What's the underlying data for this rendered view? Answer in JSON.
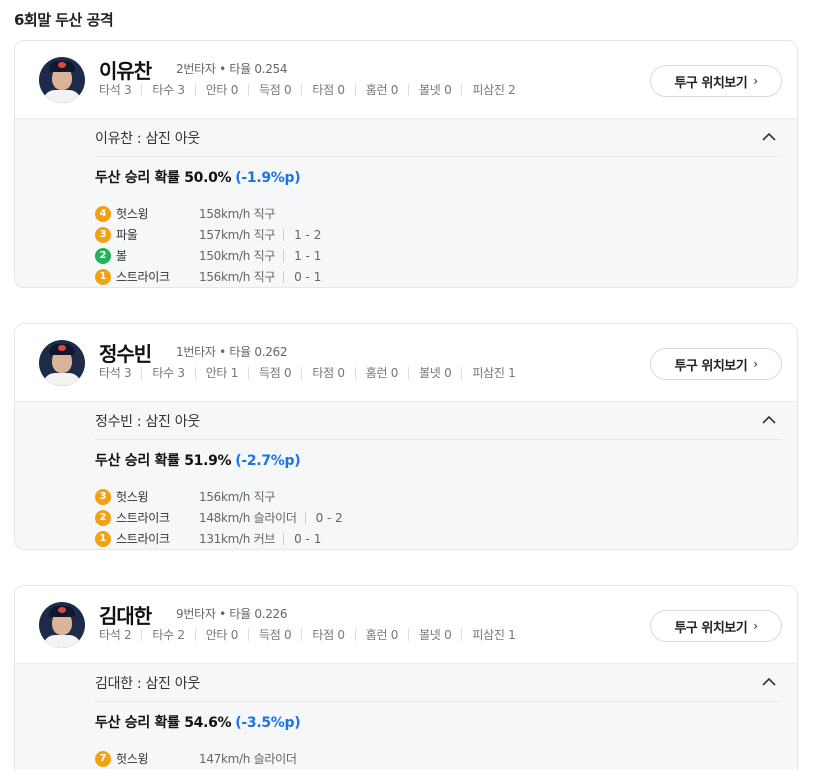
{
  "section_title": "6회말 두산 공격",
  "button_label": "투구 위치보기",
  "button_chevron": "›",
  "stat_labels": [
    "타석",
    "타수",
    "안타",
    "득점",
    "타점",
    "홈런",
    "볼넷",
    "피삼진"
  ],
  "players": [
    {
      "name": "이유찬",
      "meta": "2번타자 • 타율 0.254",
      "stats": [
        "3",
        "3",
        "0",
        "0",
        "0",
        "0",
        "0",
        "2"
      ],
      "result": "이유찬 : 삼진 아웃",
      "prob_label": "두산 승리 확률 50.0%",
      "prob_delta": "(-1.9%p)",
      "pitches": [
        {
          "num": "4",
          "color": "orange",
          "type": "헛스윙",
          "detail": "158km/h 직구",
          "count": ""
        },
        {
          "num": "3",
          "color": "orange",
          "type": "파울",
          "detail": "157km/h 직구",
          "count": "1 - 2"
        },
        {
          "num": "2",
          "color": "green",
          "type": "볼",
          "detail": "150km/h 직구",
          "count": "1 - 1"
        },
        {
          "num": "1",
          "color": "orange",
          "type": "스트라이크",
          "detail": "156km/h 직구",
          "count": "0 - 1"
        }
      ]
    },
    {
      "name": "정수빈",
      "meta": "1번타자 • 타율 0.262",
      "stats": [
        "3",
        "3",
        "1",
        "0",
        "0",
        "0",
        "0",
        "1"
      ],
      "result": "정수빈 : 삼진 아웃",
      "prob_label": "두산 승리 확률 51.9%",
      "prob_delta": "(-2.7%p)",
      "pitches": [
        {
          "num": "3",
          "color": "orange",
          "type": "헛스윙",
          "detail": "156km/h 직구",
          "count": ""
        },
        {
          "num": "2",
          "color": "orange",
          "type": "스트라이크",
          "detail": "148km/h 슬라이더",
          "count": "0 - 2"
        },
        {
          "num": "1",
          "color": "orange",
          "type": "스트라이크",
          "detail": "131km/h 커브",
          "count": "0 - 1"
        }
      ]
    },
    {
      "name": "김대한",
      "meta": "9번타자 • 타율 0.226",
      "stats": [
        "2",
        "2",
        "0",
        "0",
        "0",
        "0",
        "0",
        "1"
      ],
      "result": "김대한 : 삼진 아웃",
      "prob_label": "두산 승리 확률 54.6%",
      "prob_delta": "(-3.5%p)",
      "pitches": [
        {
          "num": "7",
          "color": "orange",
          "type": "헛스윙",
          "detail": "147km/h 슬라이더",
          "count": ""
        }
      ]
    }
  ]
}
